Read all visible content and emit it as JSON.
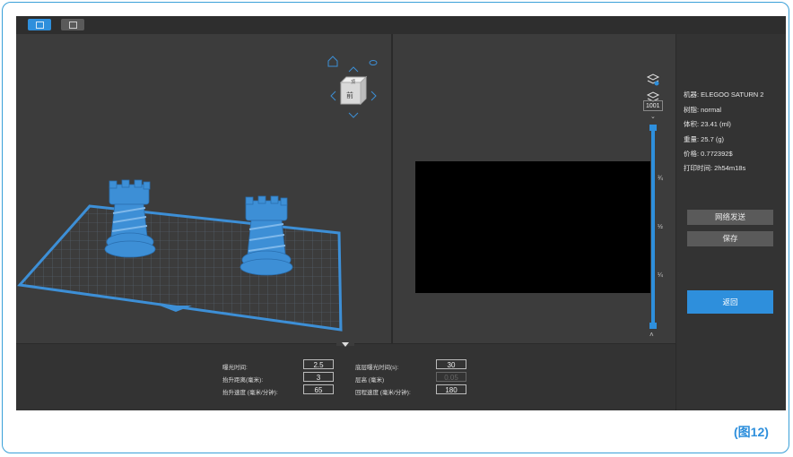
{
  "toolbar": {
    "icons": [
      "slice-icon",
      "view-dropdown-icon"
    ]
  },
  "navcube": {
    "face_label": "前",
    "top_label": "顶"
  },
  "slice_panel": {
    "layer_count": "1001",
    "fractions": [
      "¾",
      "½",
      "¼"
    ]
  },
  "info": {
    "machine": "机器:  ELEGOO SATURN 2",
    "resin": "树脂:  normal",
    "volume": "体积:  23.41  (ml)",
    "weight": "重量:  25.7  (g)",
    "price": "价格:  0.772392$",
    "time": "打印时间:  2h54m18s"
  },
  "buttons": {
    "network_send": "网络发送",
    "save": "保存",
    "back": "返回"
  },
  "params": {
    "exposure_label": "曝光时间:",
    "exposure_value": "2.5",
    "bottom_exposure_label": "底层曝光时间(s):",
    "bottom_exposure_value": "30",
    "lift_distance_label": "抬升距离(毫米):",
    "lift_distance_value": "3",
    "layer_height_label": "层高 (毫米)",
    "layer_height_value": "0.05",
    "lift_speed_label": "抬升速度 (毫米/分钟):",
    "lift_speed_value": "65",
    "retract_speed_label": "回程速度 (毫米/分钟):",
    "retract_speed_value": "180"
  },
  "caption": "(图12)",
  "colors": {
    "accent": "#2e8fdc",
    "model": "#3d8fd6",
    "background": "#3b3b3b"
  }
}
